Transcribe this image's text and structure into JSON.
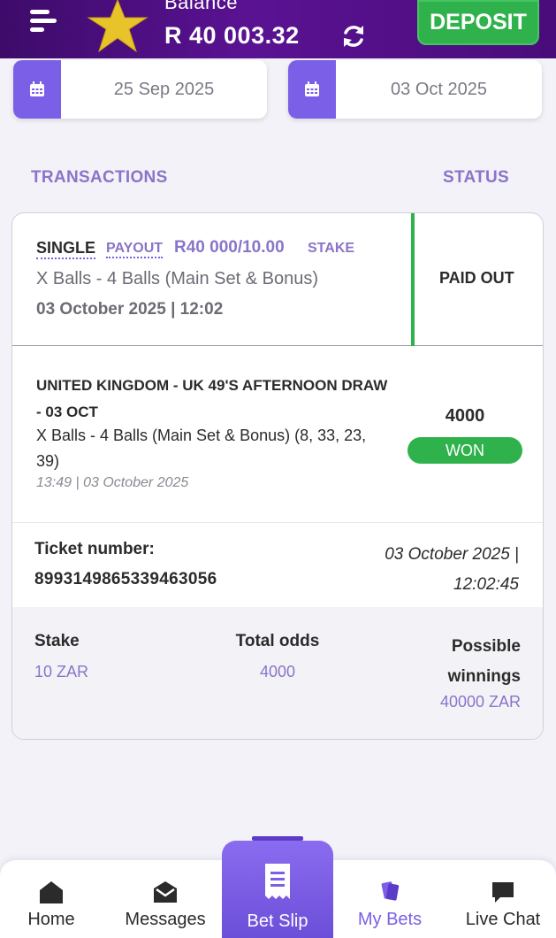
{
  "header": {
    "balance_label": "Balance",
    "balance_amount": "R 40 003.32",
    "deposit_label": "DEPOSIT",
    "colors": {
      "bar": "#4a0c7a",
      "deposit": "#2fb24c"
    }
  },
  "filters": {
    "date_from": "25 Sep 2025",
    "date_to": "03 Oct 2025"
  },
  "columns": {
    "transactions": "TRANSACTIONS",
    "status": "STATUS"
  },
  "bet": {
    "type": "SINGLE",
    "payout_label": "PAYOUT",
    "payout_value": "R40 000/10.00",
    "stake_label": "STAKE",
    "market": "X Balls - 4 Balls (Main Set & Bonus)",
    "date": "03 October 2025 | 12:02",
    "status": "PAID OUT",
    "leg": {
      "event": "UNITED KINGDOM - UK 49'S AFTERNOON DRAW - 03 OCT",
      "selection": "X Balls - 4 Balls (Main Set & Bonus) (8, 33, 23, 39)",
      "time": "13:49 | 03 October 2025",
      "odds": "4000",
      "result": "WON"
    },
    "ticket_label": "Ticket number:",
    "ticket_number": "8993149865339463056",
    "ticket_date": "03 October 2025 | 12:02:45",
    "summary": {
      "stake_label": "Stake",
      "stake_value": "10 ZAR",
      "odds_label": "Total odds",
      "odds_value": "4000",
      "winnings_label": "Possible winnings",
      "winnings_value": "40000 ZAR"
    }
  },
  "nav": {
    "home": "Home",
    "messages": "Messages",
    "betslip": "Bet Slip",
    "mybets": "My Bets",
    "livechat": "Live Chat"
  }
}
